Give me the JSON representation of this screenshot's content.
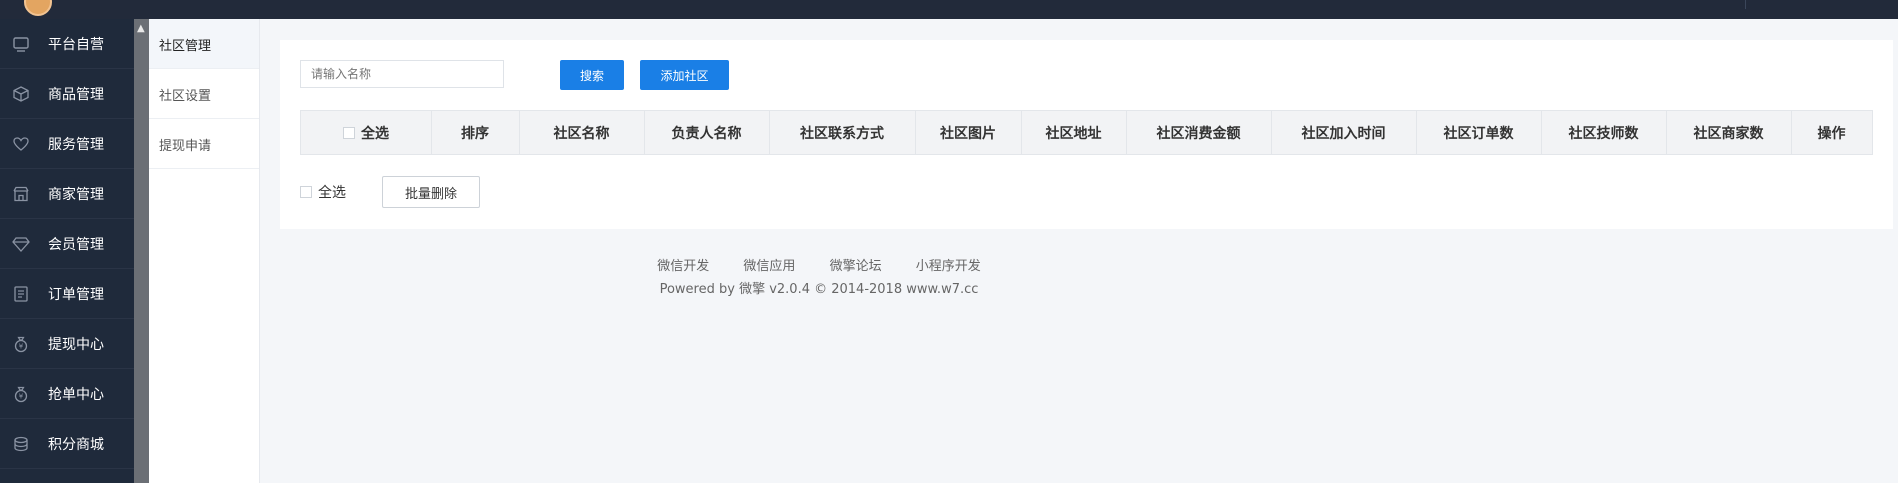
{
  "sidebar": {
    "items": [
      {
        "label": "平台自营",
        "icon": "monitor-icon"
      },
      {
        "label": "商品管理",
        "icon": "box-icon"
      },
      {
        "label": "服务管理",
        "icon": "heart-icon"
      },
      {
        "label": "商家管理",
        "icon": "store-icon"
      },
      {
        "label": "会员管理",
        "icon": "diamond-icon"
      },
      {
        "label": "订单管理",
        "icon": "document-icon"
      },
      {
        "label": "提现中心",
        "icon": "money-bag-icon"
      },
      {
        "label": "抢单中心",
        "icon": "money-bag-icon"
      },
      {
        "label": "积分商城",
        "icon": "coins-icon"
      }
    ]
  },
  "subnav": {
    "items": [
      "社区管理",
      "社区设置",
      "提现申请"
    ],
    "active_index": 0
  },
  "search": {
    "placeholder": "请输入名称",
    "search_button": "搜索",
    "add_button": "添加社区"
  },
  "table": {
    "select_all": "全选",
    "columns": [
      "排序",
      "社区名称",
      "负责人名称",
      "社区联系方式",
      "社区图片",
      "社区地址",
      "社区消费金额",
      "社区加入时间",
      "社区订单数",
      "社区技师数",
      "社区商家数",
      "操作"
    ]
  },
  "batch": {
    "select_all": "全选",
    "delete_button": "批量删除"
  },
  "footer": {
    "links": [
      "微信开发",
      "微信应用",
      "微擎论坛",
      "小程序开发"
    ],
    "copyright": "Powered by 微擎 v2.0.4 © 2014-2018 www.w7.cc"
  },
  "colors": {
    "sidebar_bg": "#1f2a3b",
    "topbar_bg": "#222a3a",
    "primary": "#1a7fe6",
    "page_bg": "#f4f6f9"
  }
}
